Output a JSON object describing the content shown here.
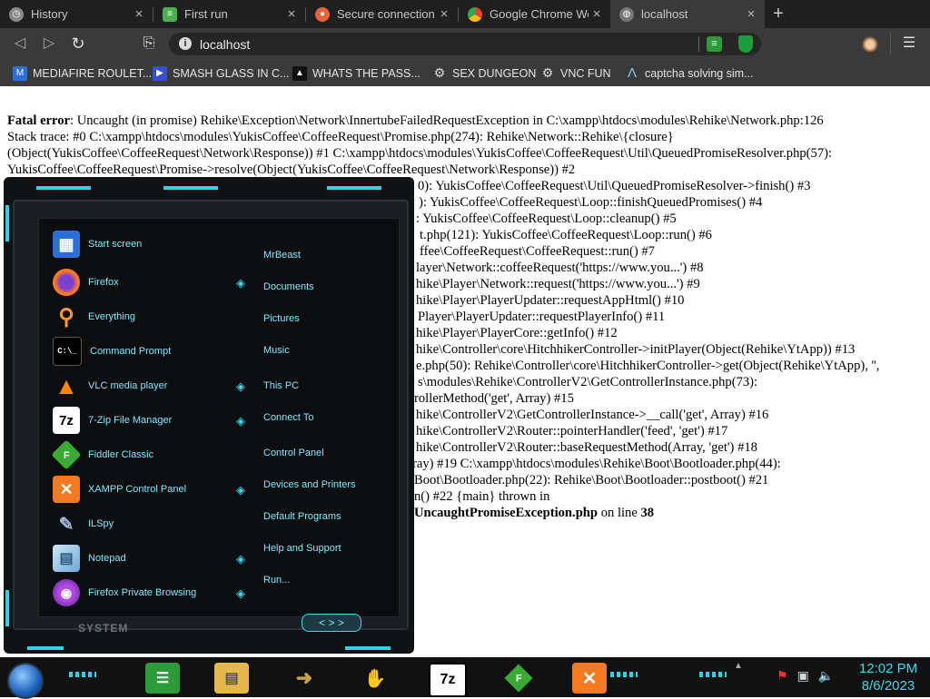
{
  "tabs": [
    {
      "title": "History",
      "icon": "history-icon",
      "color": "#8a8a8a"
    },
    {
      "title": "First run",
      "icon": "chrome-guide-icon",
      "color": "#4caf50"
    },
    {
      "title": "Secure connection fa",
      "icon": "firefox-icon",
      "color": "#e8623a"
    },
    {
      "title": "Google Chrome Wel",
      "icon": "chrome-icon",
      "color": "#4285f4"
    },
    {
      "title": "localhost",
      "icon": "globe-icon",
      "color": "#777777"
    }
  ],
  "omnibox": {
    "url": "localhost",
    "info_icon": "i"
  },
  "bookmarks": [
    {
      "label": "MEDIAFIRE ROULET...",
      "icon": "mediafire-icon",
      "color": "#2a6fd6"
    },
    {
      "label": "SMASH GLASS IN C...",
      "icon": "smash-icon",
      "color": "#3a4fd0"
    },
    {
      "label": "WHATS THE PASS...",
      "icon": "password-icon",
      "color": "#222222"
    },
    {
      "label": "SEX DUNGEON",
      "icon": "dungeon-icon",
      "color": "#dddddd"
    },
    {
      "label": "VNC FUN",
      "icon": "vnc-icon",
      "color": "#dddddd"
    },
    {
      "label": "captcha solving sim...",
      "icon": "captcha-icon",
      "color": "#7ecbff"
    }
  ],
  "error": {
    "line1_bold": "Fatal error",
    "line1_rest": ": Uncaught (in promise) Rehike\\Exception\\Network\\InnertubeFailedRequestException in C:\\xampp\\htdocs\\modules\\Rehike\\Network.php:126",
    "lines": [
      "Stack trace: #0 C:\\xampp\\htdocs\\modules\\YukisCoffee\\CoffeeRequest\\Promise.php(274): Rehike\\Network::Rehike\\{closure}",
      "(Object(YukisCoffee\\CoffeeRequest\\Network\\Response)) #1 C:\\xampp\\htdocs\\modules\\YukisCoffee\\CoffeeRequest\\Util\\QueuedPromiseResolver.php(57):",
      "YukisCoffee\\CoffeeRequest\\Promise->resolve(Object(YukisCoffee\\CoffeeRequest\\Network\\Response)) #2",
      "0): YukisCoffee\\CoffeeRequest\\Util\\QueuedPromiseResolver->finish() #3",
      "): YukisCoffee\\CoffeeRequest\\Loop::finishQueuedPromises() #4",
      ": YukisCoffee\\CoffeeRequest\\Loop::cleanup() #5",
      "t.php(121): YukisCoffee\\CoffeeRequest\\Loop::run() #6",
      "ffee\\CoffeeRequest\\CoffeeRequest::run() #7",
      "layer\\Network::coffeeRequest('https://www.you...') #8",
      "hike\\Player\\Network::request('https://www.you...') #9",
      "hike\\Player\\PlayerUpdater::requestAppHtml() #10",
      "Player\\PlayerUpdater::requestPlayerInfo() #11",
      "hike\\Player\\PlayerCore::getInfo() #12",
      "hike\\Controller\\core\\HitchhikerController->initPlayer(Object(Rehike\\YtApp)) #13",
      "e.php(50): Rehike\\Controller\\core\\HitchhikerController->get(Object(Rehike\\YtApp), '',",
      "s\\modules\\Rehike\\ControllerV2\\GetControllerInstance.php(73):",
      "rollerMethod('get', Array) #15",
      "hike\\ControllerV2\\GetControllerInstance->__call('get', Array) #16",
      "hike\\ControllerV2\\Router::pointerHandler('feed', 'get') #17",
      "hike\\ControllerV2\\Router::baseRequestMethod(Array, 'get') #18",
      "ray) #19 C:\\xampp\\htdocs\\modules\\Rehike\\Boot\\Bootloader.php(44):",
      "Boot\\Bootloader.php(22): Rehike\\Boot\\Bootloader::postboot() #21",
      "n() #22 {main} thrown in"
    ],
    "last_bold": "UncaughtPromiseException.php",
    "last_mid": " on line ",
    "last_num": "38"
  },
  "start_menu": {
    "left_items": [
      {
        "label": "Start screen",
        "icon": "start-screen-icon",
        "color": "#2a6fd6",
        "glyph": "▦"
      },
      {
        "label": "Firefox",
        "icon": "firefox-icon",
        "color": "#e8623a",
        "glyph": "●"
      },
      {
        "label": "Everything",
        "icon": "everything-icon",
        "color": "#ff9a1a",
        "glyph": "🔍"
      },
      {
        "label": "Command Prompt",
        "icon": "cmd-icon",
        "color": "#000000",
        "glyph": "C:\\"
      },
      {
        "label": "VLC media player",
        "icon": "vlc-icon",
        "color": "#ff8800",
        "glyph": "▲"
      },
      {
        "label": "7-Zip File Manager",
        "icon": "7zip-icon",
        "color": "#ffffff",
        "glyph": "7z"
      },
      {
        "label": "Fiddler Classic",
        "icon": "fiddler-icon",
        "color": "#3aaa35",
        "glyph": "F"
      },
      {
        "label": "XAMPP Control Panel",
        "icon": "xampp-icon",
        "color": "#f47920",
        "glyph": "✕"
      },
      {
        "label": "ILSpy",
        "icon": "ilspy-icon",
        "color": "#9fb7d8",
        "glyph": "✎"
      },
      {
        "label": "Notepad",
        "icon": "notepad-icon",
        "color": "#88bde6",
        "glyph": "▤"
      },
      {
        "label": "Firefox Private Browsing",
        "icon": "firefox-private-icon",
        "color": "#7b2ac0",
        "glyph": "◉"
      }
    ],
    "right_items": [
      "MrBeast",
      "Documents",
      "Pictures",
      "Music",
      "This PC",
      "Connect To",
      "Control Panel",
      "Devices and Printers",
      "Default Programs",
      "Help and Support",
      "Run..."
    ],
    "system_label": "SYSTEM",
    "nav_label": "< > >"
  },
  "taskbar": {
    "apps": [
      {
        "name": "browser",
        "icon": "chrome-guide-icon",
        "color": "#2e9b3a",
        "glyph": "☰"
      },
      {
        "name": "explorer",
        "icon": "folder-icon",
        "color": "#e6b84a",
        "glyph": "▤"
      },
      {
        "name": "move",
        "icon": "move-icon",
        "color": "#c9a34a",
        "glyph": "➜"
      },
      {
        "name": "handshake",
        "icon": "handshake-icon",
        "color": "#e2a23a",
        "glyph": "🤝"
      },
      {
        "name": "7zip",
        "icon": "7zip-icon",
        "color": "#000000",
        "glyph": "7z"
      },
      {
        "name": "fiddler",
        "icon": "fiddler-icon",
        "color": "#3aaa35",
        "glyph": "F"
      },
      {
        "name": "xampp",
        "icon": "xampp-icon",
        "color": "#f47920",
        "glyph": "✕"
      }
    ],
    "time": "12:02 PM",
    "date": "8/6/2023"
  }
}
